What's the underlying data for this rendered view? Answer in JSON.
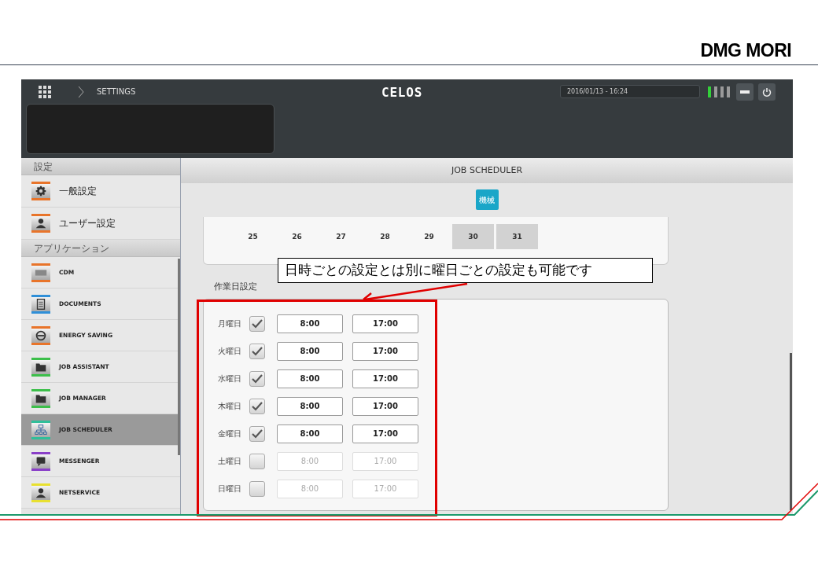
{
  "slide": {
    "logo": "DMG MORI",
    "callout": "日時ごとの設定とは別に曜日ごとの設定も可能です"
  },
  "header": {
    "breadcrumb": "SETTINGS",
    "brand": "CELOS",
    "datetime": "2016/01/13 - 16:24"
  },
  "sidebar": {
    "sections": [
      {
        "title": "設定",
        "items": [
          {
            "label": "一般設定",
            "kind": "gear",
            "color": "#e8742a",
            "selected": false
          },
          {
            "label": "ユーザー設定",
            "kind": "user",
            "color": "#e8742a",
            "selected": false
          }
        ]
      },
      {
        "title": "アプリケーション",
        "items": [
          {
            "label": "CDM",
            "kind": "cdm",
            "color": "#e8742a",
            "selected": false
          },
          {
            "label": "DOCUMENTS",
            "kind": "doc",
            "color": "#2f8fd8",
            "selected": false
          },
          {
            "label": "ENERGY SAVING",
            "kind": "energy",
            "color": "#e8742a",
            "selected": false
          },
          {
            "label": "JOB ASSISTANT",
            "kind": "folder",
            "color": "#3cbf4a",
            "selected": false
          },
          {
            "label": "JOB MANAGER",
            "kind": "folder",
            "color": "#3cbf4a",
            "selected": false
          },
          {
            "label": "JOB SCHEDULER",
            "kind": "tree",
            "color": "#2fbf9a",
            "selected": true
          },
          {
            "label": "MESSENGER",
            "kind": "msg",
            "color": "#8a3fc8",
            "selected": false
          },
          {
            "label": "NETSERVICE",
            "kind": "user",
            "color": "#e8e030",
            "selected": false
          }
        ]
      }
    ]
  },
  "main": {
    "title": "JOB SCHEDULER",
    "machine_button": "機械",
    "calendar": [
      {
        "day": "25",
        "shaded": false
      },
      {
        "day": "26",
        "shaded": false
      },
      {
        "day": "27",
        "shaded": false
      },
      {
        "day": "28",
        "shaded": false
      },
      {
        "day": "29",
        "shaded": false
      },
      {
        "day": "30",
        "shaded": true
      },
      {
        "day": "31",
        "shaded": true
      }
    ],
    "workdays": {
      "title": "作業日設定",
      "rows": [
        {
          "day": "月曜日",
          "checked": true,
          "start": "8:00",
          "end": "17:00"
        },
        {
          "day": "火曜日",
          "checked": true,
          "start": "8:00",
          "end": "17:00"
        },
        {
          "day": "水曜日",
          "checked": true,
          "start": "8:00",
          "end": "17:00"
        },
        {
          "day": "木曜日",
          "checked": true,
          "start": "8:00",
          "end": "17:00"
        },
        {
          "day": "金曜日",
          "checked": true,
          "start": "8:00",
          "end": "17:00"
        },
        {
          "day": "土曜日",
          "checked": false,
          "start": "8:00",
          "end": "17:00"
        },
        {
          "day": "日曜日",
          "checked": false,
          "start": "8:00",
          "end": "17:00"
        }
      ]
    }
  }
}
